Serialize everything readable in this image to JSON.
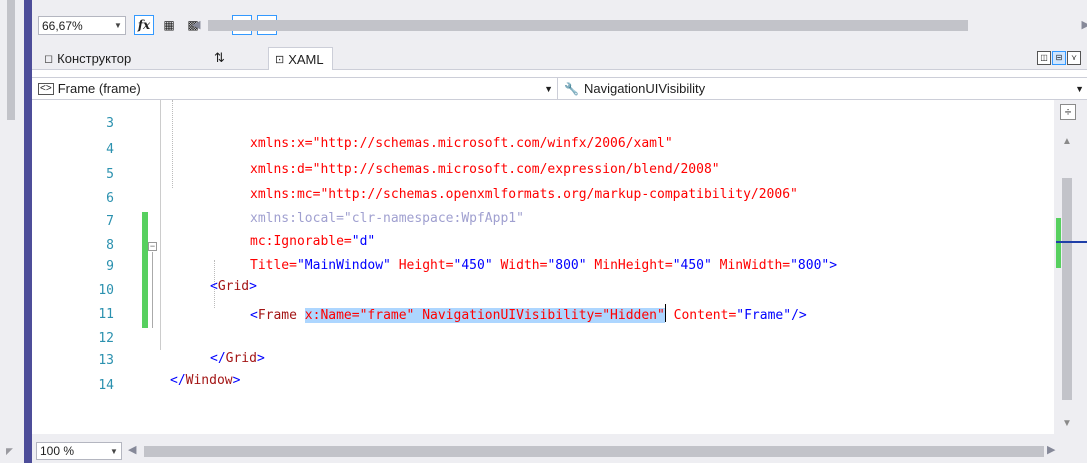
{
  "toolbar": {
    "zoom": "66,67%",
    "fx_label": "fx"
  },
  "tabs": {
    "designer_label": "Конструктор",
    "swap_label": "⇅",
    "xaml_label": "XAML"
  },
  "navbar": {
    "element": "Frame (frame)",
    "member": "NavigationUIVisibility"
  },
  "code": {
    "line_numbers": [
      "3",
      "4",
      "5",
      "6",
      "7",
      "8",
      "9",
      "10",
      "11",
      "12",
      "13",
      "14"
    ],
    "l3": "xmlns:x=\"http://schemas.microsoft.com/winfx/2006/xaml\"",
    "l4": "xmlns:d=\"http://schemas.microsoft.com/expression/blend/2008\"",
    "l5": "xmlns:mc=\"http://schemas.openxmlformats.org/markup-compatibility/2006\"",
    "l6": "xmlns:local=\"clr-namespace:WpfApp1\"",
    "l7_attr": "mc:Ignorable=",
    "l7_val": "\"d\"",
    "l8": [
      {
        "t": "Title=",
        "c": "c-attr"
      },
      {
        "t": "\"MainWindow\"",
        "c": "c-val"
      },
      {
        "t": " Height=",
        "c": "c-attr"
      },
      {
        "t": "\"450\"",
        "c": "c-val"
      },
      {
        "t": " Width=",
        "c": "c-attr"
      },
      {
        "t": "\"800\"",
        "c": "c-val"
      },
      {
        "t": " MinHeight=",
        "c": "c-attr"
      },
      {
        "t": "\"450\"",
        "c": "c-val"
      },
      {
        "t": " MinWidth=",
        "c": "c-attr"
      },
      {
        "t": "\"800\"",
        "c": "c-val"
      },
      {
        "t": ">",
        "c": "c-blue"
      }
    ],
    "l9_open": "<",
    "l9_tag": "Grid",
    "l9_close": ">",
    "l10_open": "<",
    "l10_tag": "Frame",
    "l10_sel": "x:Name=\"frame\" NavigationUIVisibility=\"Hidden\"",
    "l10_rest_attr": " Content=",
    "l10_rest_val": "\"Frame\"",
    "l10_end": "/>",
    "l12_open": "</",
    "l12_tag": "Grid",
    "l12_close": ">",
    "l13_open": "</",
    "l13_tag": "Window",
    "l13_close": ">"
  },
  "status": {
    "zoom": "100 %"
  },
  "colors": {
    "accent": "#4d4d99",
    "change_marker": "#57d05f",
    "selection": "#add6ff"
  }
}
